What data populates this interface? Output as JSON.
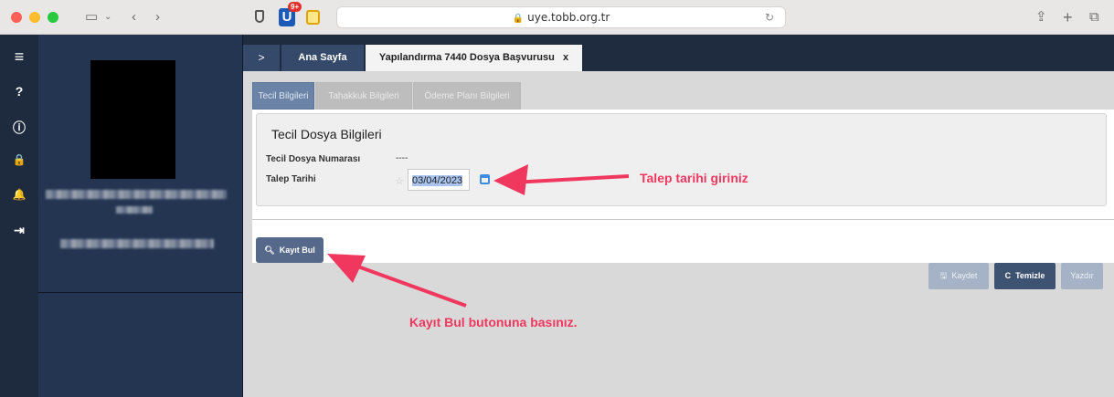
{
  "browser": {
    "url": "uye.tobb.org.tr",
    "extension_badge": "9+",
    "extension_letter": "U"
  },
  "sidebar": {
    "icons": [
      {
        "name": "menu-icon",
        "glyph": "≡"
      },
      {
        "name": "help-icon",
        "glyph": "?"
      },
      {
        "name": "info-icon",
        "glyph": "ℹ"
      },
      {
        "name": "lock-icon",
        "glyph": "🔒"
      },
      {
        "name": "bell-icon",
        "glyph": "🔔"
      },
      {
        "name": "logout-icon",
        "glyph": "⇥"
      }
    ]
  },
  "tabs": {
    "arrow": ">",
    "home": "Ana Sayfa",
    "active": "Yapılandırma 7440 Dosya Başvurusu",
    "active_close": "x"
  },
  "sub_tabs": [
    "Tecil Bilgileri",
    "Tahakkuk Bilgileri",
    "Ödeme Planı Bilgileri"
  ],
  "form": {
    "section_title": "Tecil Dosya Bilgileri",
    "file_number_label": "Tecil Dosya Numarası",
    "file_number_value": "----",
    "request_date_label": "Talep Tarihi",
    "request_date_value": "03/04/2023"
  },
  "buttons": {
    "find": "Kayıt Bul",
    "save": "Kaydet",
    "clear": "Temizle",
    "print": "Yazdır"
  },
  "annotations": {
    "date_hint": "Talep tarihi giriniz",
    "find_hint": "Kayıt Bul butonuna basınız."
  },
  "colors": {
    "annotation": "#f0385f",
    "header": "#1f2b3e",
    "active_sub_tab": "#6b83a6"
  }
}
